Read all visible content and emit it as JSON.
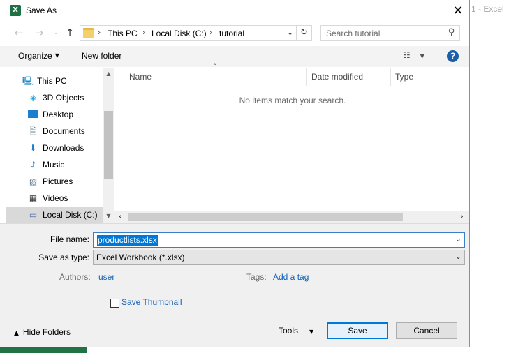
{
  "background_window": {
    "title": "1 - Excel"
  },
  "dialog": {
    "title": "Save As",
    "app_icon": "X"
  },
  "address_bar": {
    "crumbs": [
      "This PC",
      "Local Disk (C:)",
      "tutorial"
    ],
    "search_placeholder": "Search tutorial"
  },
  "toolbar": {
    "organize": "Organize",
    "new_folder": "New folder",
    "help": "?"
  },
  "nav_pane": {
    "items": [
      {
        "label": "This PC",
        "icon": "computer-icon"
      },
      {
        "label": "3D Objects",
        "icon": "cube-icon"
      },
      {
        "label": "Desktop",
        "icon": "desktop-icon"
      },
      {
        "label": "Documents",
        "icon": "document-icon"
      },
      {
        "label": "Downloads",
        "icon": "download-arrow-icon"
      },
      {
        "label": "Music",
        "icon": "music-note-icon"
      },
      {
        "label": "Pictures",
        "icon": "picture-icon"
      },
      {
        "label": "Videos",
        "icon": "film-icon"
      },
      {
        "label": "Local Disk (C:)",
        "icon": "drive-icon",
        "selected": true
      }
    ]
  },
  "file_list": {
    "columns": [
      "Name",
      "Date modified",
      "Type"
    ],
    "empty_message": "No items match your search."
  },
  "form": {
    "file_name_label": "File name:",
    "file_name_value": "productlists.xlsx",
    "save_as_type_label": "Save as type:",
    "save_as_type_value": "Excel Workbook (*.xlsx)",
    "authors_label": "Authors:",
    "authors_value": "user",
    "tags_label": "Tags:",
    "tags_value": "Add a tag",
    "thumbnail_label": "Save Thumbnail",
    "thumbnail_checked": false
  },
  "footer": {
    "hide_folders": "Hide Folders",
    "tools": "Tools",
    "save": "Save",
    "cancel": "Cancel"
  },
  "colors": {
    "excel_green": "#217346",
    "accent_blue": "#0078d7",
    "link_blue": "#1160b6"
  }
}
